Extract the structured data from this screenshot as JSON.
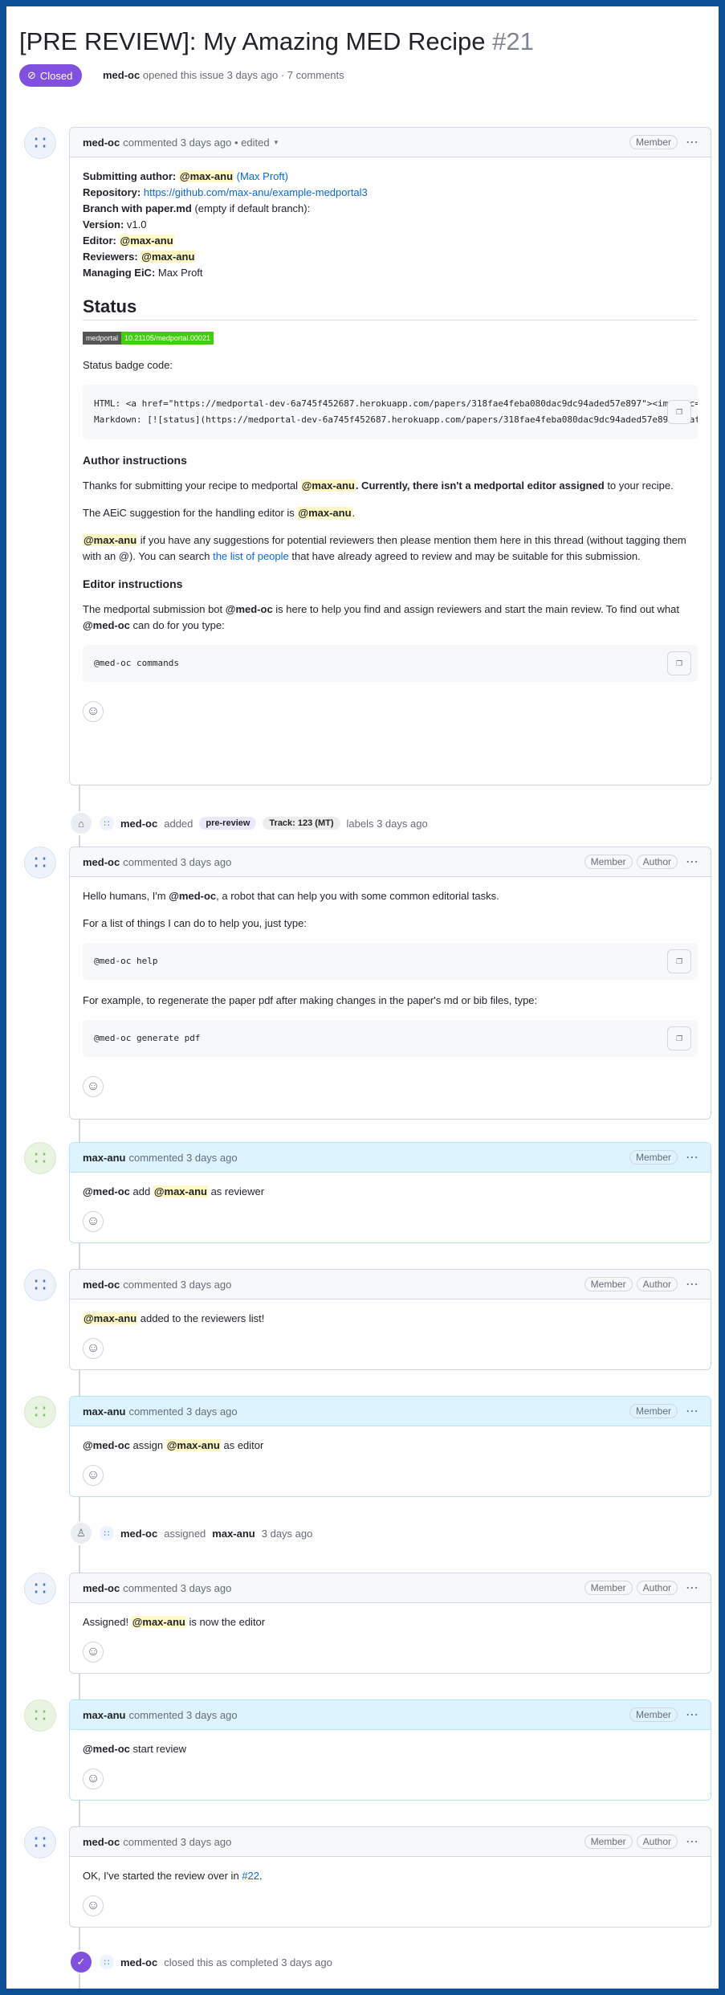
{
  "issue": {
    "title": "[PRE REVIEW]: My Amazing MED Recipe",
    "number": "#21",
    "state": "Closed",
    "opener": "med-oc",
    "meta_text": "opened this issue 3 days ago · 7 comments"
  },
  "roles": {
    "member": "Member",
    "author": "Author"
  },
  "c1": {
    "author": "med-oc",
    "meta": "commented 3 days ago • edited",
    "lines": {
      "submitting_author_label": "Submitting author:",
      "submitting_author": "@max-anu",
      "submitting_author_name": "(Max Proft)",
      "repository_label": "Repository:",
      "repository_url": "https://github.com/max-anu/example-medportal3",
      "branch_label": "Branch with paper.md",
      "branch_note": "(empty if default branch):",
      "version_label": "Version:",
      "version": "v1.0",
      "editor_label": "Editor:",
      "editor": "@max-anu",
      "reviewers_label": "Reviewers:",
      "reviewers": "@max-anu",
      "eic_label": "Managing EiC:",
      "eic": "Max Proft"
    },
    "status_heading": "Status",
    "badge_left": "medportal",
    "badge_right": "10.21105/medportal.00021",
    "status_badge_label": "Status badge code:",
    "badge_code": "HTML: <a href=\"https://medportal-dev-6a745f452687.herokuapp.com/papers/318fae4feba080dac9dc94aded57e897\"><img src=\"https://medportal-dev\nMarkdown: [![status](https://medportal-dev-6a745f452687.herokuapp.com/papers/318fae4feba080dac9dc94aded57e897/status.svg)]",
    "author_instructions_heading": "Author instructions",
    "ai_p1_a": "Thanks for submitting your recipe to medportal ",
    "ai_p1_mention": "@max-anu",
    "ai_p1_b": ". Currently, there isn't a medportal editor assigned",
    "ai_p1_c": " to your recipe.",
    "ai_p2_a": "The AEiC suggestion for the handling editor is ",
    "ai_p2_mention": "@max-anu",
    "ai_p2_b": ".",
    "ai_p3_mention": "@max-anu",
    "ai_p3_a": " if you have any suggestions for potential reviewers then please mention them here in this thread (without tagging them with an @). You can search ",
    "ai_p3_link": "the list of people",
    "ai_p3_b": " that have already agreed to review and may be suitable for this submission.",
    "editor_instructions_heading": "Editor instructions",
    "ei_p1_a": "The medportal submission bot ",
    "ei_p1_bot": "@med-oc",
    "ei_p1_b": " is here to help you find and assign reviewers and start the main review. To find out what ",
    "ei_p1_bot2": "@med-oc",
    "ei_p1_c": " can do for you type:",
    "code": "@med-oc commands"
  },
  "event_labels": {
    "actor": "med-oc",
    "action": "added",
    "label1": "pre-review",
    "label1_color": "#d4c5f9",
    "label2": "Track: 123 (MT)",
    "label2_color": "#ededed",
    "suffix": "labels 3 days ago"
  },
  "c2": {
    "author": "med-oc",
    "meta": "commented 3 days ago",
    "p1_a": "Hello humans, I'm ",
    "p1_bot": "@med-oc",
    "p1_b": ", a robot that can help you with some common editorial tasks.",
    "p2": "For a list of things I can do to help you, just type:",
    "code1": "@med-oc help",
    "p3": "For example, to regenerate the paper pdf after making changes in the paper's md or bib files, type:",
    "code2": "@med-oc generate pdf"
  },
  "c3": {
    "author": "max-anu",
    "meta": "commented 3 days ago",
    "bot": "@med-oc",
    "a": " add ",
    "mention": "@max-anu",
    "b": " as reviewer"
  },
  "c4": {
    "author": "med-oc",
    "meta": "commented 3 days ago",
    "mention": "@max-anu",
    "a": " added to the reviewers list!"
  },
  "c5": {
    "author": "max-anu",
    "meta": "commented 3 days ago",
    "bot": "@med-oc",
    "a": " assign ",
    "mention": "@max-anu",
    "b": " as editor"
  },
  "event_assigned": {
    "actor": "med-oc",
    "action": "assigned",
    "target": "max-anu",
    "suffix": "3 days ago"
  },
  "c6": {
    "author": "med-oc",
    "meta": "commented 3 days ago",
    "a": "Assigned! ",
    "mention": "@max-anu",
    "b": " is now the editor"
  },
  "c7": {
    "author": "max-anu",
    "meta": "commented 3 days ago",
    "bot": "@med-oc",
    "a": " start review"
  },
  "c8": {
    "author": "med-oc",
    "meta": "commented 3 days ago",
    "a": "OK, I've started the review over in ",
    "link": "#22",
    "b": "."
  },
  "event_closed": {
    "actor": "med-oc",
    "text": "closed this as completed 3 days ago"
  },
  "icons": {
    "closed": "check-circle-icon",
    "copy": "copy-icon",
    "smiley": "smiley-icon",
    "kebab": "kebab-horizontal-icon",
    "tag": "tag-icon",
    "person": "person-icon",
    "bot_avatar": "identicon-icon"
  }
}
